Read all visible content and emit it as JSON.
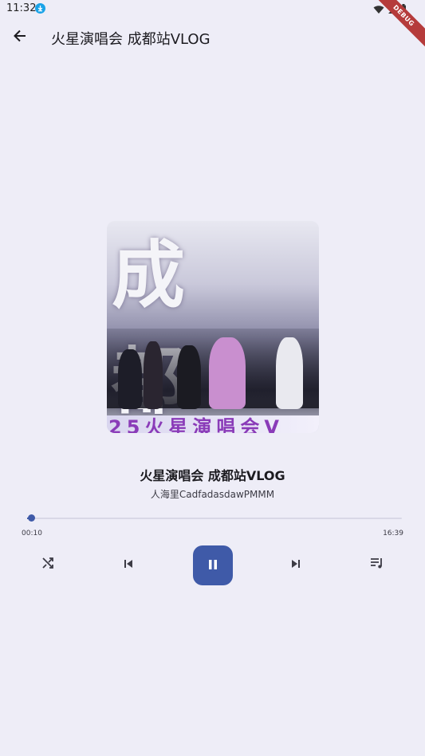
{
  "status_bar": {
    "time": "11:32",
    "debug_label": "DEBUG"
  },
  "app_bar": {
    "title": "火星演唱会 成都站VLOG",
    "back_icon": "arrow-back-icon"
  },
  "cover": {
    "top_text": "成 都",
    "banner_text": "25火星演唱会V"
  },
  "song": {
    "title": "火星演唱会 成都站VLOG",
    "artist": "人海里CadfadasdawPMMM"
  },
  "progress": {
    "elapsed": "00:10",
    "total": "16:39",
    "fraction": 0.01
  },
  "controls": {
    "shuffle_icon": "shuffle-icon",
    "previous_icon": "skip-previous-icon",
    "play_pause_icon": "pause-icon",
    "next_icon": "skip-next-icon",
    "playlist_icon": "playlist-icon"
  },
  "colors": {
    "background": "#eeedf7",
    "accent": "#3f5aa8"
  }
}
